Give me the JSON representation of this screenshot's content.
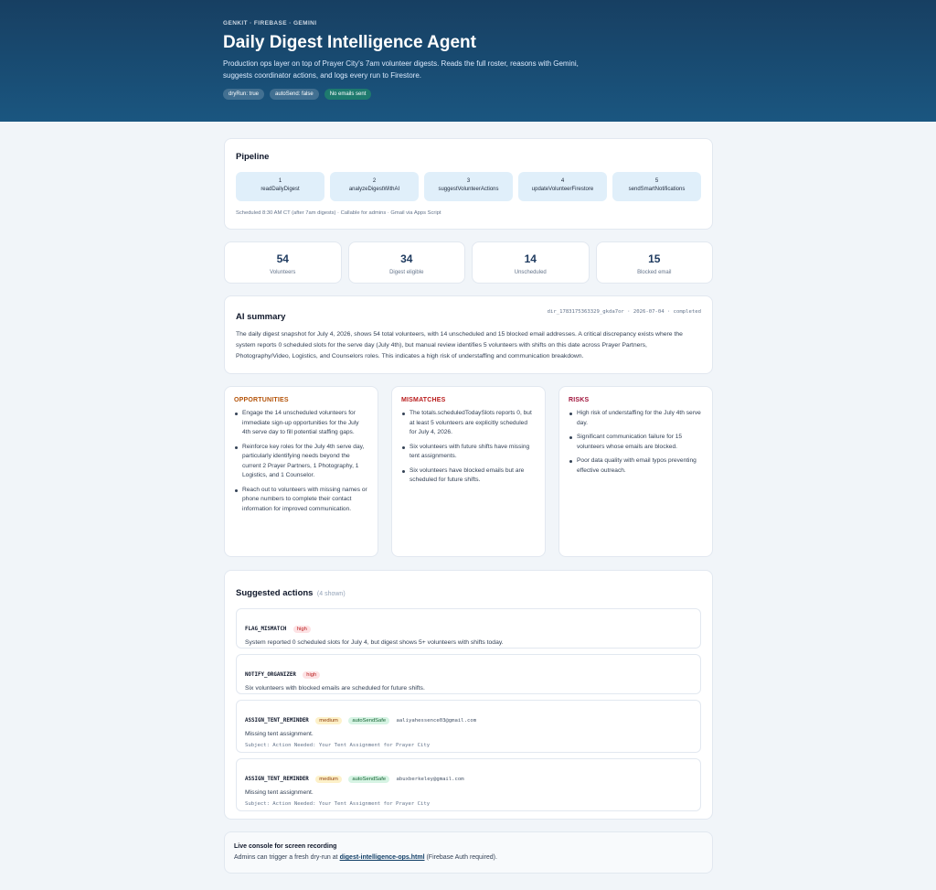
{
  "header": {
    "eyebrow": "GENKIT · FIREBASE · GEMINI",
    "title": "Daily Digest Intelligence Agent",
    "description": "Production ops layer on top of Prayer City's 7am volunteer digests. Reads the full roster, reasons with Gemini, suggests coordinator actions, and logs every run to Firestore.",
    "pills": [
      "dryRun: true",
      "autoSend: false",
      "No emails sent"
    ]
  },
  "pipeline": {
    "title": "Pipeline",
    "steps": [
      {
        "num": "1",
        "label": "readDailyDigest"
      },
      {
        "num": "2",
        "label": "analyzeDigestWithAI"
      },
      {
        "num": "3",
        "label": "suggestVolunteerActions"
      },
      {
        "num": "4",
        "label": "updateVolunteerFirestore"
      },
      {
        "num": "5",
        "label": "sendSmartNotifications"
      }
    ],
    "footnote": "Scheduled 8:30 AM CT (after 7am digests) · Callable for admins · Gmail via Apps Script"
  },
  "stats": [
    {
      "value": "54",
      "label": "Volunteers"
    },
    {
      "value": "34",
      "label": "Digest eligible"
    },
    {
      "value": "14",
      "label": "Unscheduled"
    },
    {
      "value": "15",
      "label": "Blocked email"
    }
  ],
  "summary": {
    "title": "AI summary",
    "meta": "dir_1783175363329_gkda7or · 2026-07-04 · completed",
    "text": "The daily digest snapshot for July 4, 2026, shows 54 total volunteers, with 14 unscheduled and 15 blocked email addresses. A critical discrepancy exists where the system reports 0 scheduled slots for the serve day (July 4th), but manual review identifies 5 volunteers with shifts on this date across Prayer Partners, Photography/Video, Logistics, and Counselors roles. This indicates a high risk of understaffing and communication breakdown."
  },
  "columns": {
    "opportunities": {
      "title": "OPPORTUNITIES",
      "color": "#b45309",
      "items": [
        "Engage the 14 unscheduled volunteers for immediate sign-up opportunities for the July 4th serve day to fill potential staffing gaps.",
        "Reinforce key roles for the July 4th serve day, particularly identifying needs beyond the current 2 Prayer Partners, 1 Photography, 1 Logistics, and 1 Counselor.",
        "Reach out to volunteers with missing names or phone numbers to complete their contact information for improved communication."
      ]
    },
    "mismatches": {
      "title": "MISMATCHES",
      "color": "#b91c1c",
      "items": [
        "The totals.scheduledTodaySlots reports 0, but at least 5 volunteers are explicitly scheduled for July 4, 2026.",
        "Six volunteers with future shifts have missing tent assignments.",
        "Six volunteers have blocked emails but are scheduled for future shifts."
      ]
    },
    "risks": {
      "title": "RISKS",
      "color": "#9f1239",
      "items": [
        "High risk of understaffing for the July 4th serve day.",
        "Significant communication failure for 15 volunteers whose emails are blocked.",
        "Poor data quality with email typos preventing effective outreach."
      ]
    }
  },
  "actions": {
    "title": "Suggested actions",
    "count": "(4 shown)",
    "items": [
      {
        "type": "FLAG_MISMATCH",
        "priority": "high",
        "text": "System reported 0 scheduled slots for July 4, but digest shows 5+ volunteers with shifts today."
      },
      {
        "type": "NOTIFY_ORGANIZER",
        "priority": "high",
        "text": "Six volunteers with blocked emails are scheduled for future shifts."
      },
      {
        "type": "ASSIGN_TENT_REMINDER",
        "priority": "medium",
        "badge": "autoSendSafe",
        "email": "aaliyahessence03@gmail.com",
        "text": "Missing tent assignment.",
        "subject": "Subject: Action Needed: Your Tent Assignment for Prayer City"
      },
      {
        "type": "ASSIGN_TENT_REMINDER",
        "priority": "medium",
        "badge": "autoSendSafe",
        "email": "abuxberkeley@gmail.com",
        "text": "Missing tent assignment.",
        "subject": "Subject: Action Needed: Your Tent Assignment for Prayer City"
      }
    ]
  },
  "console": {
    "title": "Live console for screen recording",
    "prefix": "Admins can trigger a fresh dry-run at",
    "link": "digest-intelligence-ops.html",
    "suffix": "(Firebase Auth required)."
  }
}
